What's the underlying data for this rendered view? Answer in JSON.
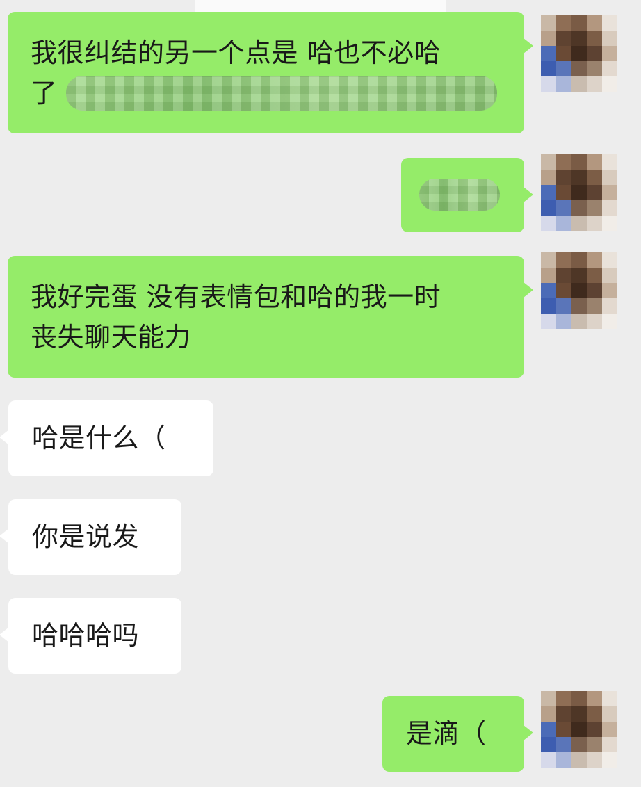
{
  "messages": [
    {
      "id": "m1",
      "direction": "outgoing",
      "lines": [
        "我很纠结的另一个点是 哈也不必哈",
        "了"
      ],
      "redacted": true
    },
    {
      "id": "m2",
      "direction": "outgoing",
      "lines": [],
      "redacted": true
    },
    {
      "id": "m3",
      "direction": "outgoing",
      "lines": [
        "我好完蛋 没有表情包和哈的我一时",
        "丧失聊天能力"
      ],
      "redacted": false
    },
    {
      "id": "m4",
      "direction": "incoming",
      "lines": [
        "哈是什么（"
      ],
      "redacted": false
    },
    {
      "id": "m5",
      "direction": "incoming",
      "lines": [
        "你是说发"
      ],
      "redacted": false
    },
    {
      "id": "m6",
      "direction": "incoming",
      "lines": [
        "哈哈哈吗"
      ],
      "redacted": false
    },
    {
      "id": "m7",
      "direction": "outgoing",
      "lines": [
        "是滴（"
      ],
      "redacted": false
    }
  ],
  "colors": {
    "background": "#ededed",
    "outgoing_bubble": "#95ec69",
    "incoming_bubble": "#ffffff",
    "text": "#191919"
  },
  "icons": {
    "avatar": "pixelated-avatar-icon",
    "redaction": "mosaic-blur"
  }
}
